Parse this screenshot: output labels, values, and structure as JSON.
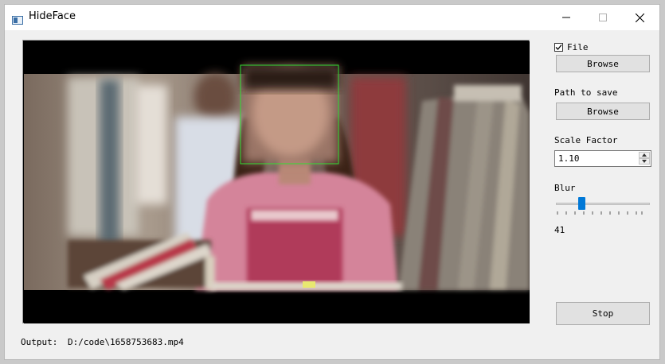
{
  "window": {
    "title": "HideFace",
    "minimize_icon": "minimize-icon",
    "maximize_icon": "maximize-icon",
    "close_icon": "close-icon"
  },
  "video": {
    "icon": "video-preview"
  },
  "output": {
    "label": "Output:",
    "path": "D:/code\\1658753683.mp4"
  },
  "controls": {
    "file_checkbox": {
      "label": "File",
      "checked": true
    },
    "file_browse_label": "Browse",
    "path_to_save_label": "Path to save",
    "save_browse_label": "Browse",
    "scale_factor_label": "Scale Factor",
    "scale_factor_value": "1.10",
    "blur_label": "Blur",
    "blur_value": "41",
    "stop_label": "Stop"
  },
  "colors": {
    "accent": "#0078d7",
    "face_box": "#33dd33"
  }
}
